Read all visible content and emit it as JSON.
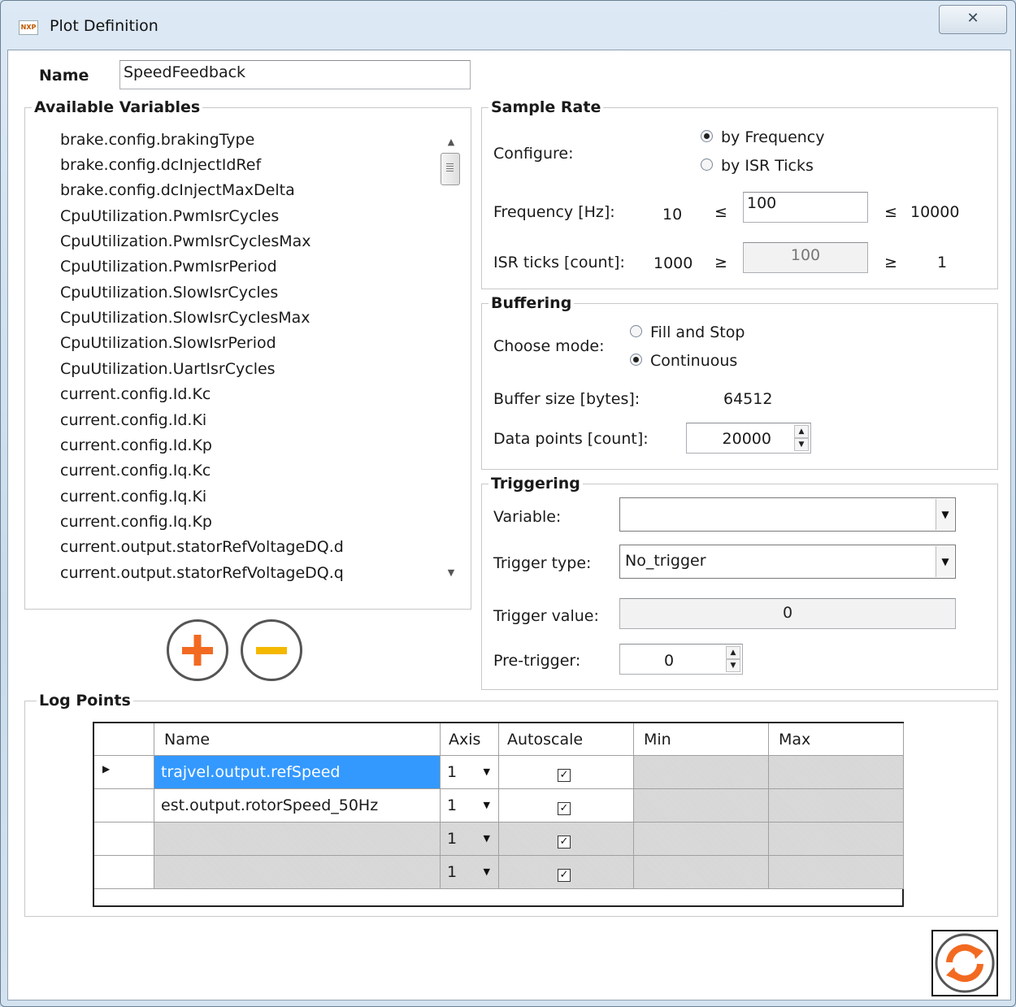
{
  "window": {
    "title": "Plot Definition",
    "close_glyph": "✕"
  },
  "name_field": {
    "label": "Name",
    "value": "SpeedFeedback"
  },
  "available_variables": {
    "label": "Available Variables",
    "items": [
      "brake.config.brakingType",
      "brake.config.dcInjectIdRef",
      "brake.config.dcInjectMaxDelta",
      "CpuUtilization.PwmIsrCycles",
      "CpuUtilization.PwmIsrCyclesMax",
      "CpuUtilization.PwmIsrPeriod",
      "CpuUtilization.SlowIsrCycles",
      "CpuUtilization.SlowIsrCyclesMax",
      "CpuUtilization.SlowIsrPeriod",
      "CpuUtilization.UartIsrCycles",
      "current.config.Id.Kc",
      "current.config.Id.Ki",
      "current.config.Id.Kp",
      "current.config.Iq.Kc",
      "current.config.Iq.Ki",
      "current.config.Iq.Kp",
      "current.output.statorRefVoltageDQ.d",
      "current.output.statorRefVoltageDQ.q"
    ]
  },
  "sample_rate": {
    "label": "Sample Rate",
    "configure_label": "Configure:",
    "options": [
      "by Frequency",
      "by ISR Ticks"
    ],
    "selected": "by Frequency",
    "frequency_label": "Frequency [Hz]:",
    "freq_min": "10",
    "le1": "≤",
    "frequency_value": "100",
    "le2": "≤",
    "freq_max": "10000",
    "isr_label": "ISR ticks [count]:",
    "isr_max": "1000",
    "ge1": "≥",
    "isr_value": "100",
    "ge2": "≥",
    "isr_min": "1"
  },
  "buffering": {
    "label": "Buffering",
    "mode_label": "Choose mode:",
    "options": [
      "Fill and Stop",
      "Continuous"
    ],
    "selected": "Continuous",
    "buffer_size_label": "Buffer size [bytes]:",
    "buffer_size_value": "64512",
    "data_points_label": "Data points [count]:",
    "data_points_value": "20000"
  },
  "triggering": {
    "label": "Triggering",
    "variable_label": "Variable:",
    "variable_value": "",
    "type_label": "Trigger type:",
    "type_value": "No_trigger",
    "value_label": "Trigger value:",
    "value_value": "0",
    "pretrigger_label": "Pre-trigger:",
    "pretrigger_value": "0"
  },
  "log_points": {
    "label": "Log Points",
    "columns": [
      "Name",
      "Axis",
      "Autoscale",
      "Min",
      "Max"
    ],
    "rows": [
      {
        "name": "trajvel.output.refSpeed",
        "axis": "1",
        "autoscale": "✓",
        "min": "",
        "max": ""
      },
      {
        "name": "est.output.rotorSpeed_50Hz",
        "axis": "1",
        "autoscale": "✓",
        "min": "",
        "max": ""
      },
      {
        "name": "",
        "axis": "1",
        "autoscale": "✓",
        "min": "",
        "max": ""
      },
      {
        "name": "",
        "axis": "1",
        "autoscale": "✓",
        "min": "",
        "max": ""
      }
    ]
  },
  "icons": {
    "add": "plus-icon",
    "remove": "minus-icon",
    "refresh": "refresh-icon"
  },
  "colors": {
    "accent_orange": "#f26a21",
    "accent_yellow": "#f5b800",
    "selection": "#3399ff"
  }
}
